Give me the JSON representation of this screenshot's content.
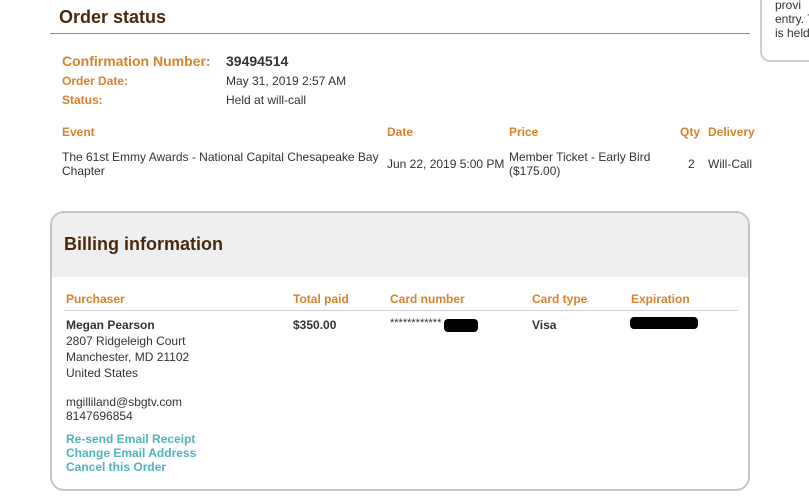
{
  "side_panel": {
    "text": "provi\nentry. T\nis held"
  },
  "page": {
    "title": "Order status"
  },
  "order": {
    "confirmation_label": "Confirmation Number:",
    "confirmation_number": "39494514",
    "order_date_label": "Order Date:",
    "order_date": "May 31, 2019 2:57 AM",
    "status_label": "Status:",
    "status": "Held at will-call"
  },
  "event_table": {
    "headers": {
      "event": "Event",
      "date": "Date",
      "price": "Price",
      "qty": "Qty",
      "delivery": "Delivery"
    },
    "rows": [
      {
        "event": "The 61st Emmy Awards - National Capital Chesapeake Bay Chapter",
        "date": "Jun 22, 2019 5:00 PM",
        "price": "Member Ticket - Early Bird ($175.00)",
        "qty": "2",
        "delivery": "Will-Call"
      }
    ]
  },
  "billing": {
    "title": "Billing information",
    "headers": {
      "purchaser": "Purchaser",
      "total_paid": "Total paid",
      "card_number": "Card number",
      "card_type": "Card type",
      "expiration": "Expiration"
    },
    "purchaser": {
      "name": "Megan Pearson",
      "address1": "2807 Ridgeleigh Court",
      "address2": "Manchester, MD 21102",
      "country": "United States",
      "email": "mgilliland@sbgtv.com",
      "phone": "8147696854"
    },
    "total_paid": "$350.00",
    "card_number": "************",
    "card_type": "Visa",
    "links": {
      "resend_receipt": "Re-send Email Receipt",
      "change_email": "Change Email Address",
      "cancel_order": "Cancel this Order"
    }
  },
  "colors": {
    "accent_orange": "#d9822b",
    "title_brown": "#4a2a0c",
    "link_teal": "#4fb3bf",
    "header_gray": "#efefef"
  }
}
